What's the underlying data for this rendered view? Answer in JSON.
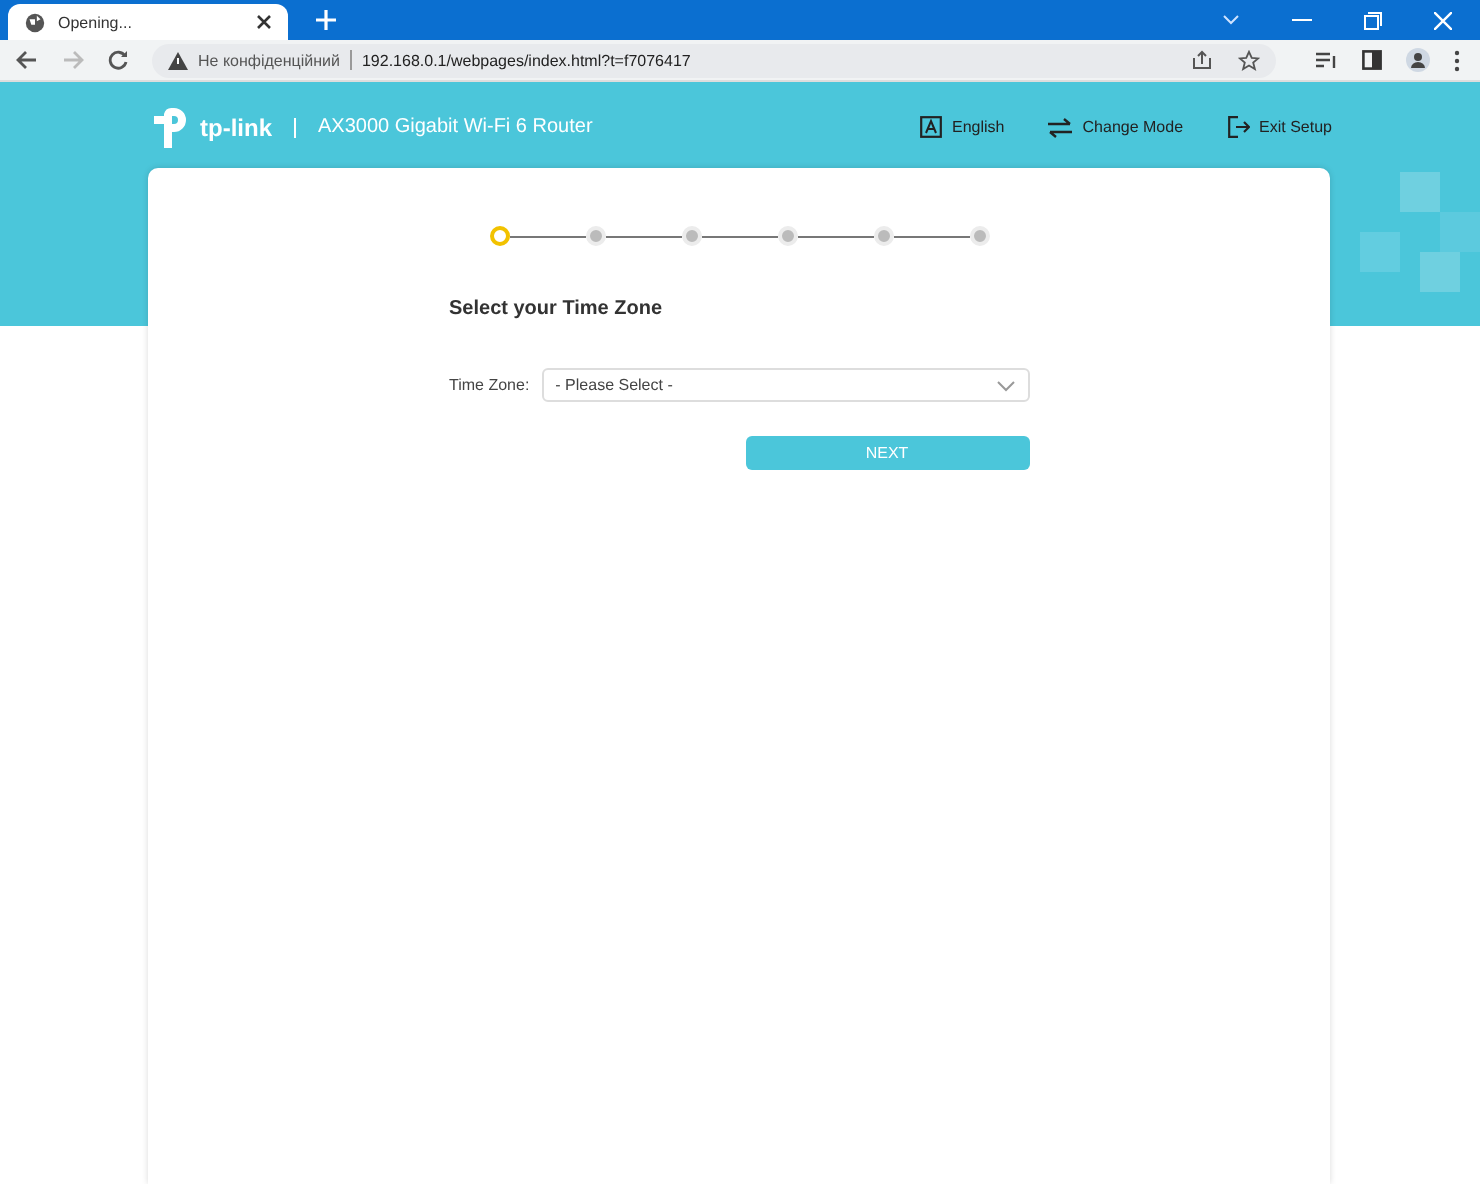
{
  "browser": {
    "tab": {
      "title": "Opening..."
    },
    "address": {
      "security": "Не конфіденційний",
      "url": "192.168.0.1/webpages/index.html?t=f7076417"
    }
  },
  "header": {
    "brand": "tp-link",
    "product": "AX3000 Gigabit Wi-Fi 6 Router",
    "actions": [
      {
        "kind": "language",
        "label": "English"
      },
      {
        "kind": "mode",
        "label": "Change Mode"
      },
      {
        "kind": "exit",
        "label": "Exit Setup"
      }
    ]
  },
  "steps": [
    {
      "current": true
    },
    {
      "current": false
    },
    {
      "current": false
    },
    {
      "current": false
    },
    {
      "current": false
    },
    {
      "current": false
    }
  ],
  "form": {
    "title": "Select your Time Zone",
    "field_label": "Time Zone:",
    "placeholder": "- Please Select -",
    "next": "NEXT"
  }
}
